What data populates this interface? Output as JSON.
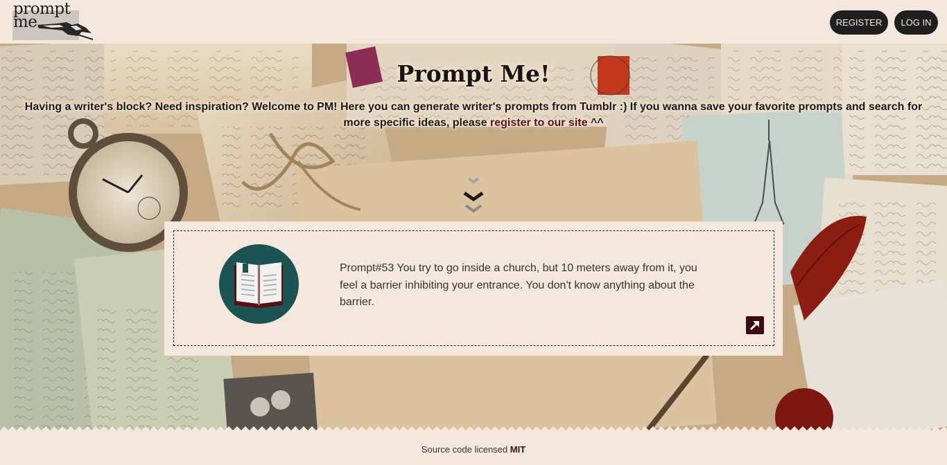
{
  "logo": {
    "text_line1": "prompt",
    "text_line2": "me"
  },
  "nav": {
    "register_label": "REGISTER",
    "login_label": "LOG IN"
  },
  "hero": {
    "title": "Prompt Me!",
    "subtitle_part1": "Having a writer's block? Need inspiration? Welcome to PM! Here you can generate writer's prompts from Tumblr :) If you wanna save your favorite prompts and search for more specific ideas, please ",
    "subtitle_link": "register to our site",
    "subtitle_part2": " ^^"
  },
  "prompt": {
    "text": "Prompt#53 You try to go inside a church, but 10 meters away from it, you feel a barrier inhibiting your entrance. You don't know anything about the barrier."
  },
  "footer": {
    "text": "Source code licensed ",
    "license": "MIT"
  },
  "colors": {
    "page_bg": "#f3e7de",
    "nav_button_bg": "#1f1f1f",
    "accent_dark_red": "#3b0c14",
    "book_circle": "#1e5354"
  },
  "icons": [
    "logo-hand-pen-icon",
    "chevron-down-icon",
    "open-book-icon",
    "external-link-arrow-icon"
  ]
}
